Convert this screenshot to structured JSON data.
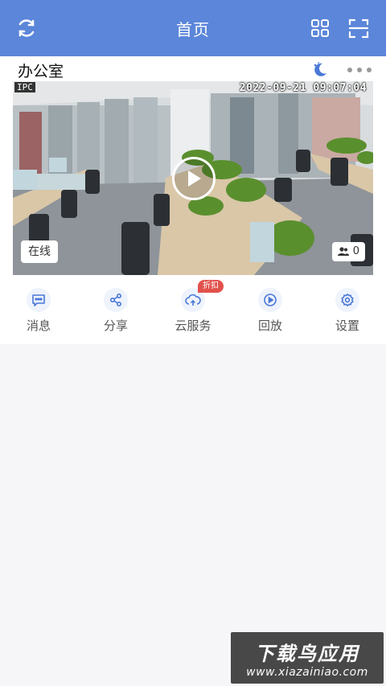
{
  "header": {
    "title": "首页",
    "left_icon": "refresh-icon",
    "right_icons": [
      "grid-view-icon",
      "scan-icon"
    ],
    "background": "#5b86d9"
  },
  "device": {
    "name": "办公室",
    "night_mode_icon": "moon-icon",
    "more_icon": "more-dots-icon",
    "video": {
      "ipc_label": "IPC",
      "timestamp": "2022-09-21 09:07:04",
      "status": "在线",
      "viewer_count": "0"
    }
  },
  "actions": [
    {
      "label": "消息",
      "icon": "message-icon"
    },
    {
      "label": "分享",
      "icon": "share-icon"
    },
    {
      "label": "云服务",
      "icon": "cloud-service-icon",
      "badge": "折扣"
    },
    {
      "label": "回放",
      "icon": "playback-icon"
    },
    {
      "label": "设置",
      "icon": "settings-icon"
    }
  ],
  "accent_color": "#5b86d9",
  "badge_color": "#e2514c",
  "watermark": {
    "line1": "下载鸟应用",
    "line2": "www.xiazainiao.com"
  }
}
